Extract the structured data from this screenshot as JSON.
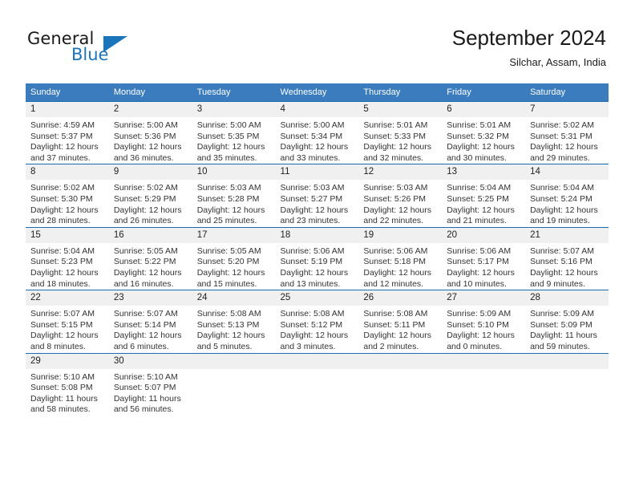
{
  "brand": {
    "name_part1": "General",
    "name_part2": "Blue",
    "flag_icon": "triangle-flag-icon",
    "accent_color": "#1b75bb"
  },
  "header": {
    "month_title": "September 2024",
    "location": "Silchar, Assam, India"
  },
  "colors": {
    "header_row_bg": "#3a7cbe",
    "row_border": "#1b6cb0",
    "daynum_bg": "#f0f0f0",
    "text": "#333333"
  },
  "weekday_headers": [
    "Sunday",
    "Monday",
    "Tuesday",
    "Wednesday",
    "Thursday",
    "Friday",
    "Saturday"
  ],
  "weeks": [
    [
      {
        "day": "1",
        "sunrise": "Sunrise: 4:59 AM",
        "sunset": "Sunset: 5:37 PM",
        "daylight_line1": "Daylight: 12 hours",
        "daylight_line2": "and 37 minutes."
      },
      {
        "day": "2",
        "sunrise": "Sunrise: 5:00 AM",
        "sunset": "Sunset: 5:36 PM",
        "daylight_line1": "Daylight: 12 hours",
        "daylight_line2": "and 36 minutes."
      },
      {
        "day": "3",
        "sunrise": "Sunrise: 5:00 AM",
        "sunset": "Sunset: 5:35 PM",
        "daylight_line1": "Daylight: 12 hours",
        "daylight_line2": "and 35 minutes."
      },
      {
        "day": "4",
        "sunrise": "Sunrise: 5:00 AM",
        "sunset": "Sunset: 5:34 PM",
        "daylight_line1": "Daylight: 12 hours",
        "daylight_line2": "and 33 minutes."
      },
      {
        "day": "5",
        "sunrise": "Sunrise: 5:01 AM",
        "sunset": "Sunset: 5:33 PM",
        "daylight_line1": "Daylight: 12 hours",
        "daylight_line2": "and 32 minutes."
      },
      {
        "day": "6",
        "sunrise": "Sunrise: 5:01 AM",
        "sunset": "Sunset: 5:32 PM",
        "daylight_line1": "Daylight: 12 hours",
        "daylight_line2": "and 30 minutes."
      },
      {
        "day": "7",
        "sunrise": "Sunrise: 5:02 AM",
        "sunset": "Sunset: 5:31 PM",
        "daylight_line1": "Daylight: 12 hours",
        "daylight_line2": "and 29 minutes."
      }
    ],
    [
      {
        "day": "8",
        "sunrise": "Sunrise: 5:02 AM",
        "sunset": "Sunset: 5:30 PM",
        "daylight_line1": "Daylight: 12 hours",
        "daylight_line2": "and 28 minutes."
      },
      {
        "day": "9",
        "sunrise": "Sunrise: 5:02 AM",
        "sunset": "Sunset: 5:29 PM",
        "daylight_line1": "Daylight: 12 hours",
        "daylight_line2": "and 26 minutes."
      },
      {
        "day": "10",
        "sunrise": "Sunrise: 5:03 AM",
        "sunset": "Sunset: 5:28 PM",
        "daylight_line1": "Daylight: 12 hours",
        "daylight_line2": "and 25 minutes."
      },
      {
        "day": "11",
        "sunrise": "Sunrise: 5:03 AM",
        "sunset": "Sunset: 5:27 PM",
        "daylight_line1": "Daylight: 12 hours",
        "daylight_line2": "and 23 minutes."
      },
      {
        "day": "12",
        "sunrise": "Sunrise: 5:03 AM",
        "sunset": "Sunset: 5:26 PM",
        "daylight_line1": "Daylight: 12 hours",
        "daylight_line2": "and 22 minutes."
      },
      {
        "day": "13",
        "sunrise": "Sunrise: 5:04 AM",
        "sunset": "Sunset: 5:25 PM",
        "daylight_line1": "Daylight: 12 hours",
        "daylight_line2": "and 21 minutes."
      },
      {
        "day": "14",
        "sunrise": "Sunrise: 5:04 AM",
        "sunset": "Sunset: 5:24 PM",
        "daylight_line1": "Daylight: 12 hours",
        "daylight_line2": "and 19 minutes."
      }
    ],
    [
      {
        "day": "15",
        "sunrise": "Sunrise: 5:04 AM",
        "sunset": "Sunset: 5:23 PM",
        "daylight_line1": "Daylight: 12 hours",
        "daylight_line2": "and 18 minutes."
      },
      {
        "day": "16",
        "sunrise": "Sunrise: 5:05 AM",
        "sunset": "Sunset: 5:22 PM",
        "daylight_line1": "Daylight: 12 hours",
        "daylight_line2": "and 16 minutes."
      },
      {
        "day": "17",
        "sunrise": "Sunrise: 5:05 AM",
        "sunset": "Sunset: 5:20 PM",
        "daylight_line1": "Daylight: 12 hours",
        "daylight_line2": "and 15 minutes."
      },
      {
        "day": "18",
        "sunrise": "Sunrise: 5:06 AM",
        "sunset": "Sunset: 5:19 PM",
        "daylight_line1": "Daylight: 12 hours",
        "daylight_line2": "and 13 minutes."
      },
      {
        "day": "19",
        "sunrise": "Sunrise: 5:06 AM",
        "sunset": "Sunset: 5:18 PM",
        "daylight_line1": "Daylight: 12 hours",
        "daylight_line2": "and 12 minutes."
      },
      {
        "day": "20",
        "sunrise": "Sunrise: 5:06 AM",
        "sunset": "Sunset: 5:17 PM",
        "daylight_line1": "Daylight: 12 hours",
        "daylight_line2": "and 10 minutes."
      },
      {
        "day": "21",
        "sunrise": "Sunrise: 5:07 AM",
        "sunset": "Sunset: 5:16 PM",
        "daylight_line1": "Daylight: 12 hours",
        "daylight_line2": "and 9 minutes."
      }
    ],
    [
      {
        "day": "22",
        "sunrise": "Sunrise: 5:07 AM",
        "sunset": "Sunset: 5:15 PM",
        "daylight_line1": "Daylight: 12 hours",
        "daylight_line2": "and 8 minutes."
      },
      {
        "day": "23",
        "sunrise": "Sunrise: 5:07 AM",
        "sunset": "Sunset: 5:14 PM",
        "daylight_line1": "Daylight: 12 hours",
        "daylight_line2": "and 6 minutes."
      },
      {
        "day": "24",
        "sunrise": "Sunrise: 5:08 AM",
        "sunset": "Sunset: 5:13 PM",
        "daylight_line1": "Daylight: 12 hours",
        "daylight_line2": "and 5 minutes."
      },
      {
        "day": "25",
        "sunrise": "Sunrise: 5:08 AM",
        "sunset": "Sunset: 5:12 PM",
        "daylight_line1": "Daylight: 12 hours",
        "daylight_line2": "and 3 minutes."
      },
      {
        "day": "26",
        "sunrise": "Sunrise: 5:08 AM",
        "sunset": "Sunset: 5:11 PM",
        "daylight_line1": "Daylight: 12 hours",
        "daylight_line2": "and 2 minutes."
      },
      {
        "day": "27",
        "sunrise": "Sunrise: 5:09 AM",
        "sunset": "Sunset: 5:10 PM",
        "daylight_line1": "Daylight: 12 hours",
        "daylight_line2": "and 0 minutes."
      },
      {
        "day": "28",
        "sunrise": "Sunrise: 5:09 AM",
        "sunset": "Sunset: 5:09 PM",
        "daylight_line1": "Daylight: 11 hours",
        "daylight_line2": "and 59 minutes."
      }
    ],
    [
      {
        "day": "29",
        "sunrise": "Sunrise: 5:10 AM",
        "sunset": "Sunset: 5:08 PM",
        "daylight_line1": "Daylight: 11 hours",
        "daylight_line2": "and 58 minutes."
      },
      {
        "day": "30",
        "sunrise": "Sunrise: 5:10 AM",
        "sunset": "Sunset: 5:07 PM",
        "daylight_line1": "Daylight: 11 hours",
        "daylight_line2": "and 56 minutes."
      },
      {
        "day": "",
        "sunrise": "",
        "sunset": "",
        "daylight_line1": "",
        "daylight_line2": ""
      },
      {
        "day": "",
        "sunrise": "",
        "sunset": "",
        "daylight_line1": "",
        "daylight_line2": ""
      },
      {
        "day": "",
        "sunrise": "",
        "sunset": "",
        "daylight_line1": "",
        "daylight_line2": ""
      },
      {
        "day": "",
        "sunrise": "",
        "sunset": "",
        "daylight_line1": "",
        "daylight_line2": ""
      },
      {
        "day": "",
        "sunrise": "",
        "sunset": "",
        "daylight_line1": "",
        "daylight_line2": ""
      }
    ]
  ]
}
